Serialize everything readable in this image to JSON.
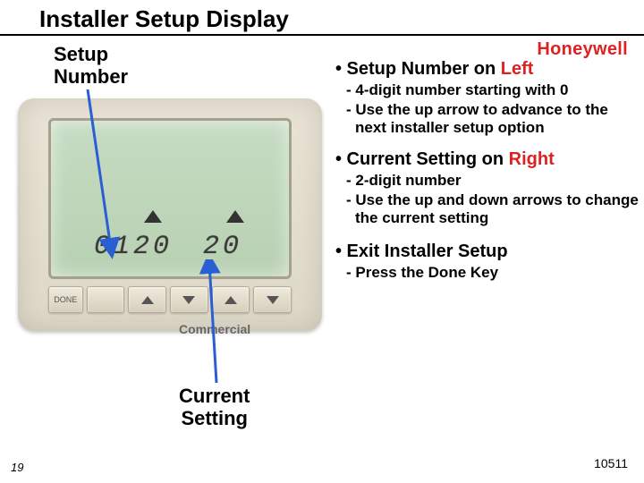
{
  "title": "Installer Setup Display",
  "brand": "Honeywell",
  "labels": {
    "setup_number": "Setup\nNumber",
    "current_setting": "Current\nSetting",
    "commercial": "Commercial"
  },
  "device": {
    "setup_value": "0120",
    "current_value": "20",
    "done_label": "DONE"
  },
  "notes": {
    "b1": {
      "pre": "• Setup Number on ",
      "hl": "Left"
    },
    "b1s1": "4-digit number starting with 0",
    "b1s2": "Use the up arrow to advance to the next installer setup option",
    "b2": {
      "pre": "• Current Setting on ",
      "hl": "Right"
    },
    "b2s1": "2-digit number",
    "b2s2": "Use the up and down arrows to change the current setting",
    "b3": "• Exit Installer Setup",
    "b3s1": "Press the Done Key"
  },
  "footer": {
    "page": "19",
    "code": "10511"
  }
}
